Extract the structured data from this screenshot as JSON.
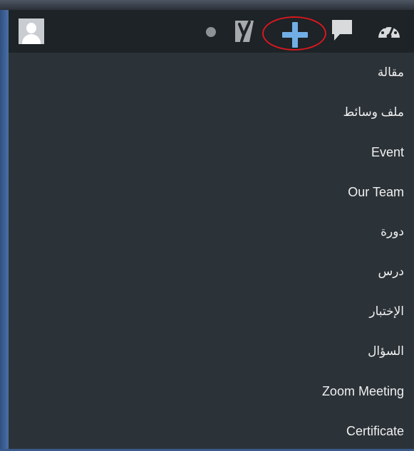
{
  "menu": {
    "items": [
      {
        "label": "مقالة"
      },
      {
        "label": "ملف وسائط"
      },
      {
        "label": "Event"
      },
      {
        "label": "Our Team"
      },
      {
        "label": "دورة"
      },
      {
        "label": "درس"
      },
      {
        "label": "الإختبار"
      },
      {
        "label": "السؤال"
      },
      {
        "label": "Zoom Meeting"
      },
      {
        "label": "Certificate"
      }
    ]
  },
  "colors": {
    "admin_bar_bg": "#1d2327",
    "menu_bg": "#2c3338",
    "menu_text": "#f0f0f1",
    "plus_accent": "#72aee6",
    "highlight_circle": "#d7181e"
  },
  "icons": [
    "avatar-icon",
    "status-dot-icon",
    "yoast-icon",
    "plus-icon",
    "comment-icon",
    "dashboard-gauge-icon"
  ]
}
